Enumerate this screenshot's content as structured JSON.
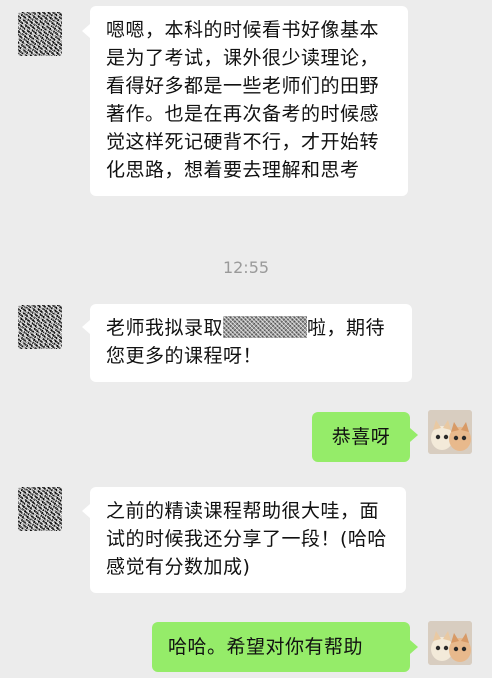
{
  "messages": [
    {
      "side": "left",
      "text": "嗯嗯，本科的时候看书好像基本是为了考试，课外很少读理论，看得好多都是一些老师们的田野著作。也是在再次备考的时候感觉这样死记硬背不行，才开始转化思路，想着要去理解和思考"
    },
    {
      "side": "left",
      "text_before": "老师我拟录取",
      "redacted": true,
      "text_after": "啦，期待您更多的课程呀！"
    },
    {
      "side": "right",
      "text": "恭喜呀"
    },
    {
      "side": "left",
      "text": "之前的精读课程帮助很大哇，面试的时候我还分享了一段！(哈哈感觉有分数加成)"
    },
    {
      "side": "right",
      "text": "哈哈。希望对你有帮助"
    }
  ],
  "timestamp": "12:55",
  "icons": {
    "left_avatar": "pixelated-avatar-icon",
    "right_avatar": "cat-avatar-icon"
  },
  "colors": {
    "background": "#ececec",
    "incoming_bubble": "#ffffff",
    "outgoing_bubble": "#95ec69",
    "timestamp": "#9a9a9a"
  }
}
